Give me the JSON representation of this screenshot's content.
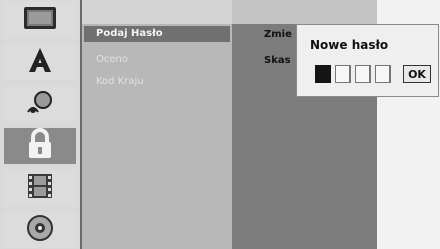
{
  "menu": {
    "items": [
      {
        "label": "Podaj Hasło",
        "state": "active"
      },
      {
        "label": "Oceno",
        "state": "disabled"
      },
      {
        "label": "Kod Kraju",
        "state": "disabled"
      }
    ]
  },
  "options": {
    "change": "Zmie",
    "delete": "Skas"
  },
  "password_popup": {
    "title": "Nowe hasło",
    "digits_entered": 1,
    "digits_total": 4,
    "ok_label": "OK"
  },
  "icons": [
    "tv-icon",
    "language-icon",
    "audio-icon",
    "lock-icon",
    "film-icon",
    "disc-icon"
  ],
  "colors": {
    "selected_menu_bg": "#707070",
    "selected_icon_bg": "#8a8a8a"
  }
}
